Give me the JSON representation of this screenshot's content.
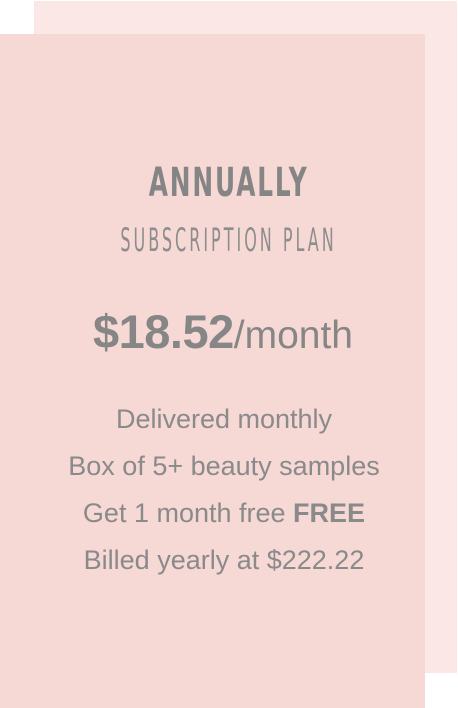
{
  "plan": {
    "title": "ANNUALLY",
    "subtitle": "SUBSCRIPTION PLAN",
    "price": "$18.52",
    "period": "/month",
    "features": [
      "Delivered monthly",
      "Box of 5+ beauty samples",
      "Get 1 month free",
      "Billed yearly at $222.22"
    ],
    "free_badge": "FREE"
  },
  "colors": {
    "front_card": "#f6d8d5",
    "back_card": "#fbe8e6",
    "text": "#868686"
  }
}
